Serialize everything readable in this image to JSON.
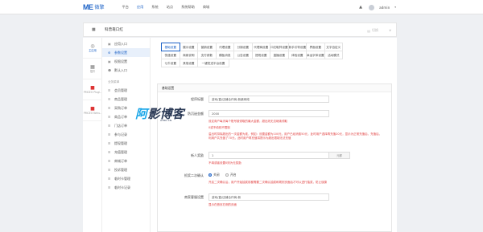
{
  "app": {
    "logo_text": "ME",
    "logo_cn": "微擎",
    "nav": [
      "平台",
      "应用",
      "系统",
      "站点",
      "系统帮助",
      "商城"
    ],
    "active_nav_index": 1,
    "user": "admin",
    "colors": {
      "accent": "#1e63c7",
      "warning": "#e03c3c"
    }
  },
  "subhead": {
    "title": "科普靠口红",
    "switch_label": "切换"
  },
  "rail": [
    {
      "icon": "globe-icon",
      "label": "主应用"
    },
    {
      "icon": "grid-icon",
      "label": "插件"
    },
    {
      "icon": "app-icon",
      "label": "PMCEO Plugi.."
    },
    {
      "icon": "app-icon",
      "label": "PMCEO Kehu.."
    }
  ],
  "menu": {
    "top": [
      "应用入口",
      "参数设置",
      "权限设置",
      "默认入口"
    ],
    "section": "业务菜单",
    "items": [
      "会员管理",
      "商品管理",
      "采购订单",
      "商品订单",
      "门店订单",
      "参与记录",
      "提现管理",
      "充值管理",
      "商城订单",
      "投诉管理",
      "临时卡管理",
      "临时卡记录"
    ]
  },
  "tabs": {
    "rows": [
      [
        "基础设置",
        "展示设置",
        "营销设置",
        "代理设置",
        "分销设置",
        "代理商设置",
        "口红取样设置",
        "新手引导设置",
        "界面设置",
        "文字自定义"
      ],
      [
        "快递设置",
        "商家说明",
        "支付参数",
        "模板消息",
        "公告设置",
        "提现设置",
        "直播设置",
        "体验设置",
        "幸运字体设置",
        "活动模式"
      ],
      [
        "七牛设置",
        "其他设置",
        "一键发送平台设置"
      ]
    ],
    "active": "基础设置"
  },
  "panel": {
    "header": "基础设置",
    "fields": {
      "site_title": {
        "label": "程序标题",
        "value": "游戏/直/店铺合作商-新蔬网络"
      },
      "daily_limit": {
        "label": "防沉迷金额",
        "value": "2000",
        "hint1": "设定商户每天每个账号被领取的最大金额，超出则无法继续领取",
        "hint2": "0或不填则不限制",
        "hint3": "溢出时扣除超出的一次金额为准，例如：设置金额为100元，用户已经消费50元，此时用户选择再充值20元，显示为正常充值后，充值后，利用户共充值了70元，此时用户再充值将提示为超出限制无法充值"
      },
      "new_user": {
        "label": "新人奖励",
        "value": "1",
        "btn": "元额",
        "hint": "不填或者设置0则为无奖励"
      },
      "second_confirm": {
        "label": "抓奖二次确认",
        "opt_off": "关闭",
        "opt_on": "开启",
        "selected": "关闭",
        "hint": "开启二次确认后，用户开始抽奖前都需要二次确认抽奖和规则页面后才可以进行抽奖，防止误操"
      },
      "service_phone": {
        "label": "商家客服设置",
        "value": "游戏/直/店铺合作商-新",
        "hint": "显示在首页右侧的页面"
      }
    }
  },
  "watermark": {
    "text_a": "阿",
    "text_b": "影博客",
    "sub": "AYBK.CN"
  }
}
